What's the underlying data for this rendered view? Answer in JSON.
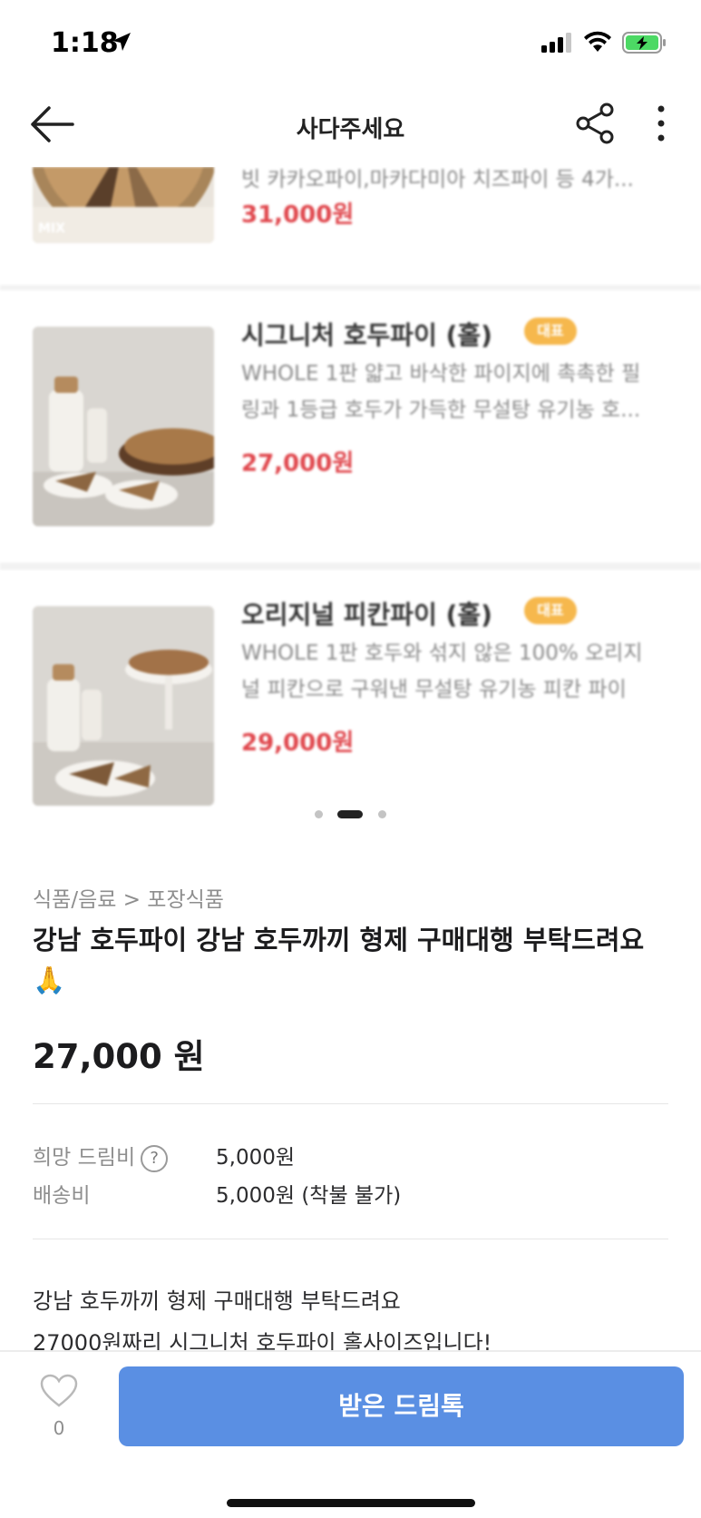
{
  "status_bar": {
    "time": "1:18"
  },
  "nav": {
    "title": "사다주세요"
  },
  "carousel": {
    "items": [
      {
        "name": "",
        "desc_line2": "빗 카카오파이,마카다미아 치즈파이 등 4가...",
        "price": "31,000원",
        "badge": ""
      },
      {
        "name": "시그니처 호두파이 (홀)",
        "badge": "대표",
        "desc_line1": "WHOLE 1판 얇고 바삭한 파이지에 촉촉한 필",
        "desc_line2": "링과 1등급 호두가 가득한 무설탕 유기농 호...",
        "price": "27,000원"
      },
      {
        "name": "오리지널 피칸파이 (홀)",
        "badge": "대표",
        "desc_line1": "WHOLE 1판 호두와 섞지 않은 100% 오리지",
        "desc_line2": "널 피칸으로 구워낸 무설탕 유기농 피칸 파이",
        "price": "29,000원"
      }
    ],
    "active_index": 1,
    "page_count": 3,
    "first_thumb_label": "MIX"
  },
  "product": {
    "category": "식품/음료 > 포장식품",
    "title": "강남 호두파이 강남 호두까끼 형제 구매대행 부탁드려요🙏",
    "price": "27,000 원",
    "fee_label": "희망 드림비",
    "fee_help": "?",
    "fee_value": "5,000원",
    "shipping_label": "배송비",
    "shipping_value": "5,000원 (착불 불가)",
    "description_lines": [
      "강남 호두까끼 형제 구매대행 부탁드려요",
      "27000원짜리 시그니처 호두파이 홀사이즈입니다!"
    ]
  },
  "bottom_bar": {
    "like_count": "0",
    "cta_label": "받은 드림톡"
  },
  "colors": {
    "accent_blue": "#5a8fe3",
    "price_red": "#e0484e",
    "badge_orange": "#f6b84d"
  }
}
